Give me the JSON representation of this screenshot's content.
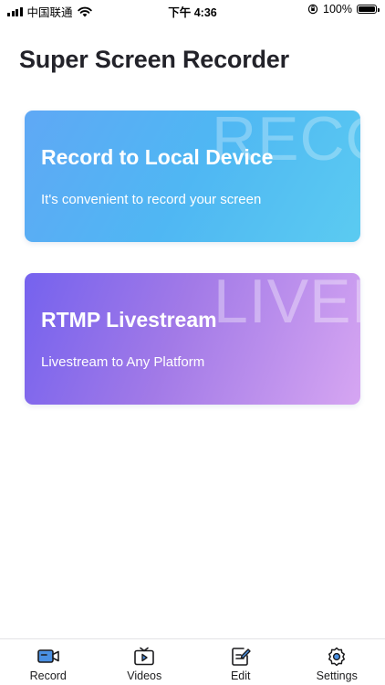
{
  "status_bar": {
    "carrier": "中国联通",
    "time": "下午 4:36",
    "battery": "100%"
  },
  "app": {
    "title": "Super Screen Recorder"
  },
  "cards": [
    {
      "watermark": "RECO",
      "title": "Record to Local Device",
      "subtitle": "It's convenient to record your screen"
    },
    {
      "watermark": "LIVEE",
      "title": "RTMP Livestream",
      "subtitle": "Livestream to Any Platform"
    }
  ],
  "tab_bar": {
    "items": [
      {
        "label": "Record",
        "icon": "camera-icon",
        "active": true
      },
      {
        "label": "Videos",
        "icon": "tv-play-icon",
        "active": false
      },
      {
        "label": "Edit",
        "icon": "edit-icon",
        "active": false
      },
      {
        "label": "Settings",
        "icon": "gear-icon",
        "active": false
      }
    ]
  },
  "colors": {
    "record_card_start": "#5fa8f5",
    "record_card_end": "#5bcbf1",
    "live_card_start": "#7562ee",
    "live_card_end": "#d6a6f2",
    "active_icon": "#4a90e2"
  }
}
